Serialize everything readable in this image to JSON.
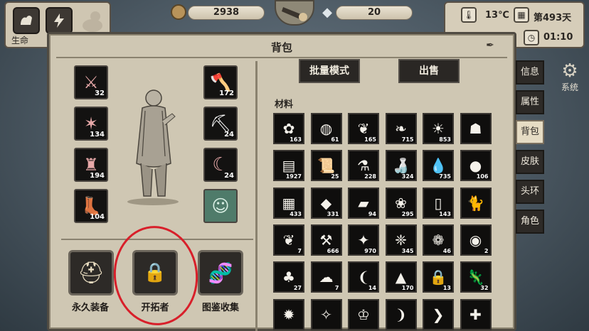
{
  "hud": {
    "life_label": "生命",
    "coins": "2938",
    "diamonds": "20",
    "temperature": "13℃",
    "day": "第493天",
    "time": "01:10",
    "system_label": "系统"
  },
  "panel": {
    "title": "背包"
  },
  "equipment": {
    "left": [
      {
        "icon": "flaming-sword-icon",
        "glyph": "⚔",
        "qty": "32"
      },
      {
        "icon": "claw-weapon-icon",
        "glyph": "✶",
        "qty": "134"
      },
      {
        "icon": "chest-armor-icon",
        "glyph": "♜",
        "qty": "194"
      },
      {
        "icon": "boots-icon",
        "glyph": "👢",
        "qty": "104"
      }
    ],
    "right": [
      {
        "icon": "axe-icon",
        "glyph": "🪓",
        "qty": "172"
      },
      {
        "icon": "pickaxe-icon",
        "glyph": "⛏",
        "qty": "24"
      },
      {
        "icon": "sickle-icon",
        "glyph": "☾",
        "qty": "24"
      },
      {
        "icon": "elf-companion-icon",
        "glyph": "☺",
        "qty": ""
      }
    ]
  },
  "features": [
    {
      "label": "永久装备",
      "icon": "helmet-icon",
      "glyph": "⛑"
    },
    {
      "label": "开拓者",
      "icon": "locked-atom-icon",
      "glyph": "🔒"
    },
    {
      "label": "图鉴收集",
      "icon": "dna-icon",
      "glyph": "🧬"
    }
  ],
  "inventory": {
    "batch_mode_label": "批量模式",
    "sell_label": "出售",
    "section_label": "材料",
    "items": [
      {
        "icon": "flower-icon",
        "glyph": "✿",
        "qty": "163"
      },
      {
        "icon": "eggs-nest-icon",
        "glyph": "◍",
        "qty": "61"
      },
      {
        "icon": "coral-icon",
        "glyph": "❦",
        "qty": "165"
      },
      {
        "icon": "herb-icon",
        "glyph": "❧",
        "qty": "715"
      },
      {
        "icon": "light-bulb-icon",
        "glyph": "☀",
        "qty": "853"
      },
      {
        "icon": "slime-icon",
        "glyph": "☗",
        "qty": ""
      },
      {
        "icon": "wood-planks-icon",
        "glyph": "▤",
        "qty": "1927"
      },
      {
        "icon": "scroll-icon",
        "glyph": "📜",
        "qty": "25"
      },
      {
        "icon": "potion-icon",
        "glyph": "⚗",
        "qty": "228"
      },
      {
        "icon": "bottle-icon",
        "glyph": "🍶",
        "qty": "324"
      },
      {
        "icon": "water-drop-icon",
        "glyph": "💧",
        "qty": "735"
      },
      {
        "icon": "ore-lumps-icon",
        "glyph": "●",
        "qty": "106"
      },
      {
        "icon": "stone-bricks-icon",
        "glyph": "▦",
        "qty": "433"
      },
      {
        "icon": "crystal-icon",
        "glyph": "◆",
        "qty": "331"
      },
      {
        "icon": "cloth-icon",
        "glyph": "▰",
        "qty": "94"
      },
      {
        "icon": "feather-icon",
        "glyph": "❀",
        "qty": "295"
      },
      {
        "icon": "dog-tags-icon",
        "glyph": "▯",
        "qty": "143"
      },
      {
        "icon": "cat-icon",
        "glyph": "🐈",
        "qty": ""
      },
      {
        "icon": "sprout-icon",
        "glyph": "❦",
        "qty": "7"
      },
      {
        "icon": "shovel-icon",
        "glyph": "⚒",
        "qty": "666"
      },
      {
        "icon": "pink-crystal-icon",
        "glyph": "✦",
        "qty": "970"
      },
      {
        "icon": "wings-icon",
        "glyph": "❈",
        "qty": "345"
      },
      {
        "icon": "butterfly-icon",
        "glyph": "❁",
        "qty": "46"
      },
      {
        "icon": "orb-icon",
        "glyph": "◉",
        "qty": "2"
      },
      {
        "icon": "mushroom-icon",
        "glyph": "♣",
        "qty": "27"
      },
      {
        "icon": "fur-icon",
        "glyph": "☁",
        "qty": "7"
      },
      {
        "icon": "tooth-icon",
        "glyph": "❨",
        "qty": "14"
      },
      {
        "icon": "sand-pile-icon",
        "glyph": "▲",
        "qty": "170"
      },
      {
        "icon": "lock-ore-icon",
        "glyph": "🔒",
        "qty": "13"
      },
      {
        "icon": "lizard-icon",
        "glyph": "🦎",
        "qty": "32"
      },
      {
        "icon": "flame-icon",
        "glyph": "✹",
        "qty": ""
      },
      {
        "icon": "shard-icon",
        "glyph": "✧",
        "qty": ""
      },
      {
        "icon": "crown-icon",
        "glyph": "♔",
        "qty": ""
      },
      {
        "icon": "tusk-icon",
        "glyph": "❩",
        "qty": ""
      },
      {
        "icon": "claw-icon",
        "glyph": "❯",
        "qty": ""
      },
      {
        "icon": "bone-icon",
        "glyph": "✚",
        "qty": ""
      }
    ]
  },
  "tabs": [
    {
      "label": "信息",
      "active": false
    },
    {
      "label": "属性",
      "active": false
    },
    {
      "label": "背包",
      "active": true
    },
    {
      "label": "皮肤",
      "active": false
    },
    {
      "label": "头环",
      "active": false
    },
    {
      "label": "角色",
      "active": false
    }
  ]
}
